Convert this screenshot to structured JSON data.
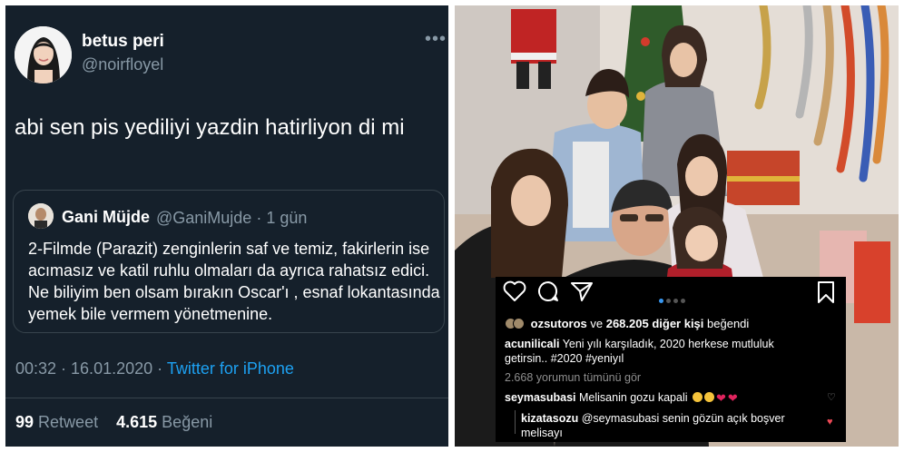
{
  "tweet": {
    "display_name": "betus peri",
    "handle": "@noirfloyel",
    "text": "abi sen pis yediliyi yazdin hatirliyon di mi",
    "more_icon": "more-horizontal-icon",
    "quoted": {
      "name": "Gani Müjde",
      "handle_time": "@GaniMujde · 1 gün",
      "text": "2-Filmde (Parazit) zenginlerin saf ve temiz, fakirlerin ise acımasız ve katil ruhlu olmaları da ayrıca rahatsız edici. Ne biliyim ben olsam bırakın Oscar'ı , esnaf lokantasında yemek bile vermem yönetmenine."
    },
    "timestamp": "00:32 · 16.01.2020 · ",
    "source": "Twitter for iPhone",
    "retweets": "99",
    "retweets_label": "Retweet",
    "likes": "4.615",
    "likes_label": "Beğeni"
  },
  "instagram": {
    "icons": [
      "heart-outline-icon",
      "comment-icon",
      "share-icon",
      "bookmark-icon"
    ],
    "carousel_active": 0,
    "carousel_count": 4,
    "liked_by_user": "ozsutoros",
    "liked_by_connector": " ve ",
    "liked_by_count": "268.205 diğer kişi",
    "liked_by_suffix": " beğendi",
    "caption_user": "acunilicali",
    "caption_text": " Yeni yılı karşıladık, 2020 herkese mutluluk getirsin.. #2020 #yeniyıl",
    "view_comments": "2.668 yorumun tümünü gör",
    "comment1_user": "seymasubasi",
    "comment1_text": " Melisanin gozu kapali ",
    "comment2_user": "kizatasozu",
    "comment2_text": " @seymasubasi senin gözün açık boşver melisayı",
    "colors": {
      "like_red": "#ed4956",
      "dot_active": "#3897f0",
      "twitter_bg": "#15202b",
      "twitter_link": "#1da1f2"
    }
  }
}
